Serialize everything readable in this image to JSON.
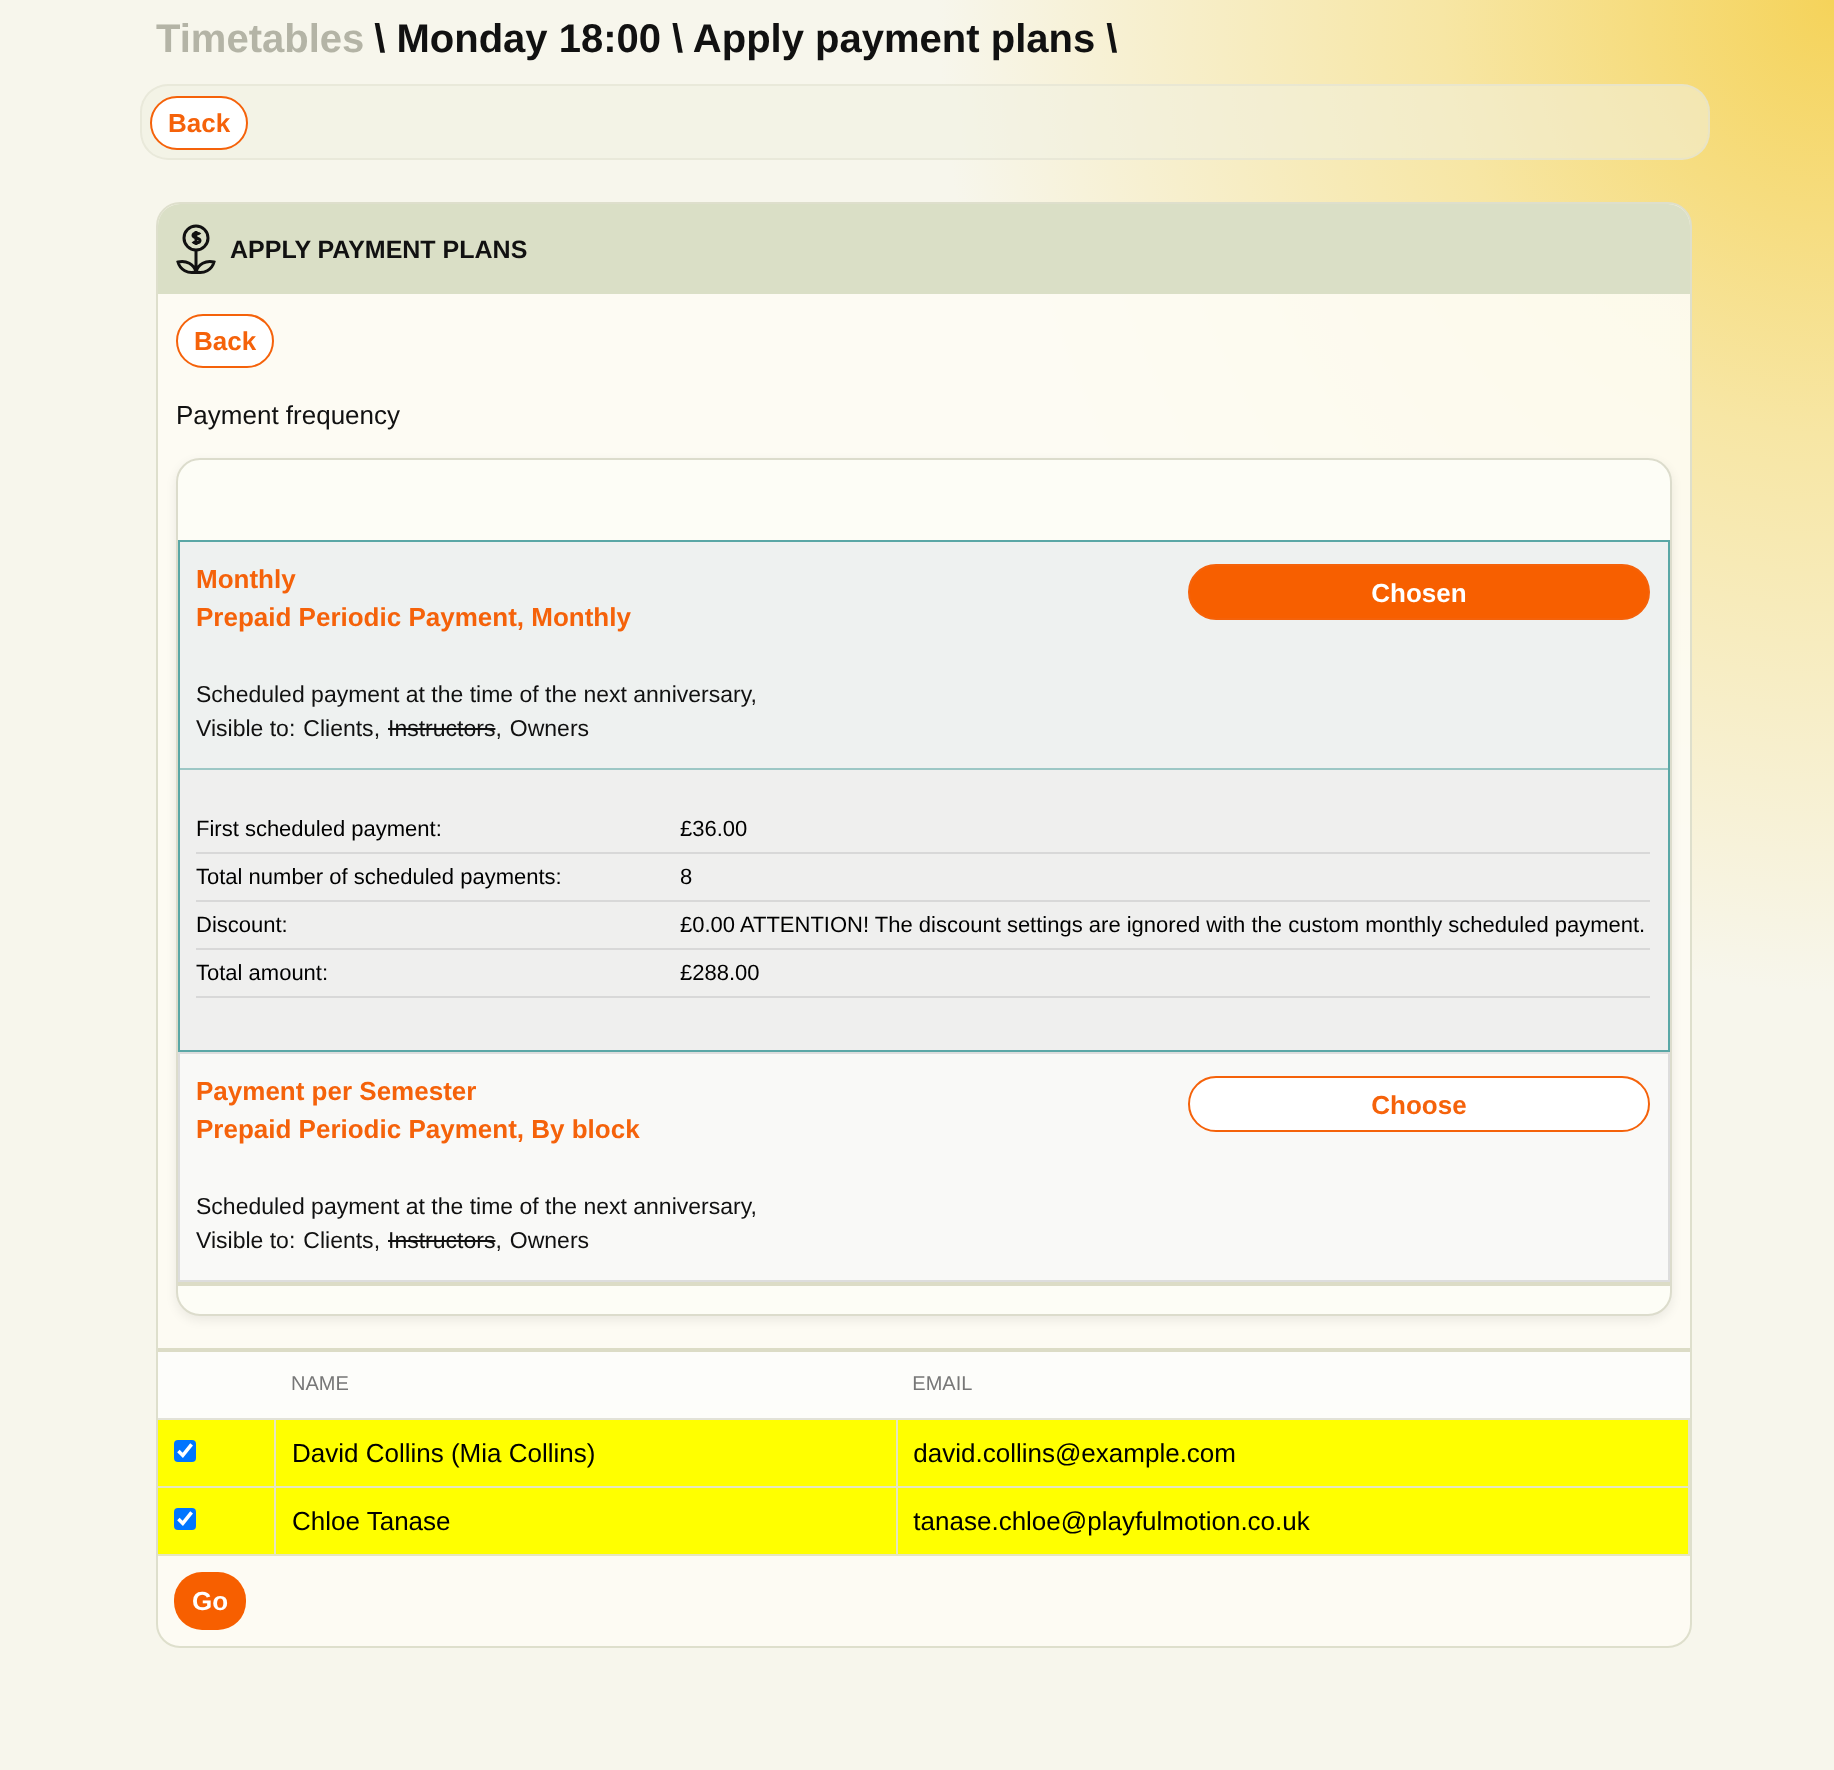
{
  "breadcrumb": [
    {
      "label": "Timetables",
      "kind": "link"
    },
    {
      "label": "\\ Monday 18:00 \\ Apply payment plans \\",
      "kind": "current"
    }
  ],
  "top_bar": {
    "back_button": "Back"
  },
  "card": {
    "title": "APPLY PAYMENT PLANS",
    "back_button": "Back",
    "frequency_label": "Payment frequency",
    "plans": [
      {
        "name": "Monthly",
        "type": "Prepaid Periodic Payment, Monthly",
        "button": "Chosen",
        "selected": true,
        "description": "Scheduled payment at the time of the next anniversary,",
        "visibility_label": "Visible to:",
        "separator": ",",
        "audiences": [
          {
            "label": "Clients",
            "struck": false
          },
          {
            "label": "Instructors",
            "struck": true
          },
          {
            "label": "Owners",
            "struck": false
          }
        ],
        "details": [
          {
            "label": "First scheduled payment:",
            "value": "£36.00"
          },
          {
            "label": "Total number of scheduled payments:",
            "value": "8"
          },
          {
            "label": "Discount:",
            "value": "£0.00 ATTENTION! The discount settings are ignored with the custom monthly scheduled payment."
          },
          {
            "label": "Total amount:",
            "value": "£288.00"
          }
        ]
      },
      {
        "name": "Payment per Semester",
        "type": "Prepaid Periodic Payment, By block",
        "button": "Choose",
        "selected": false,
        "description": "Scheduled payment at the time of the next anniversary,",
        "visibility_label": "Visible to:",
        "separator": ",",
        "audiences": [
          {
            "label": "Clients",
            "struck": false
          },
          {
            "label": "Instructors",
            "struck": true
          },
          {
            "label": "Owners",
            "struck": false
          }
        ]
      }
    ],
    "table": {
      "columns": [
        "NAME",
        "EMAIL"
      ],
      "rows": [
        {
          "checked": true,
          "name": "David Collins (Mia Collins)",
          "email": "david.collins@example.com"
        },
        {
          "checked": true,
          "name": "Chloe Tanase",
          "email": "tanase.chloe@playfulmotion.co.uk"
        }
      ]
    },
    "go_button": "Go"
  }
}
